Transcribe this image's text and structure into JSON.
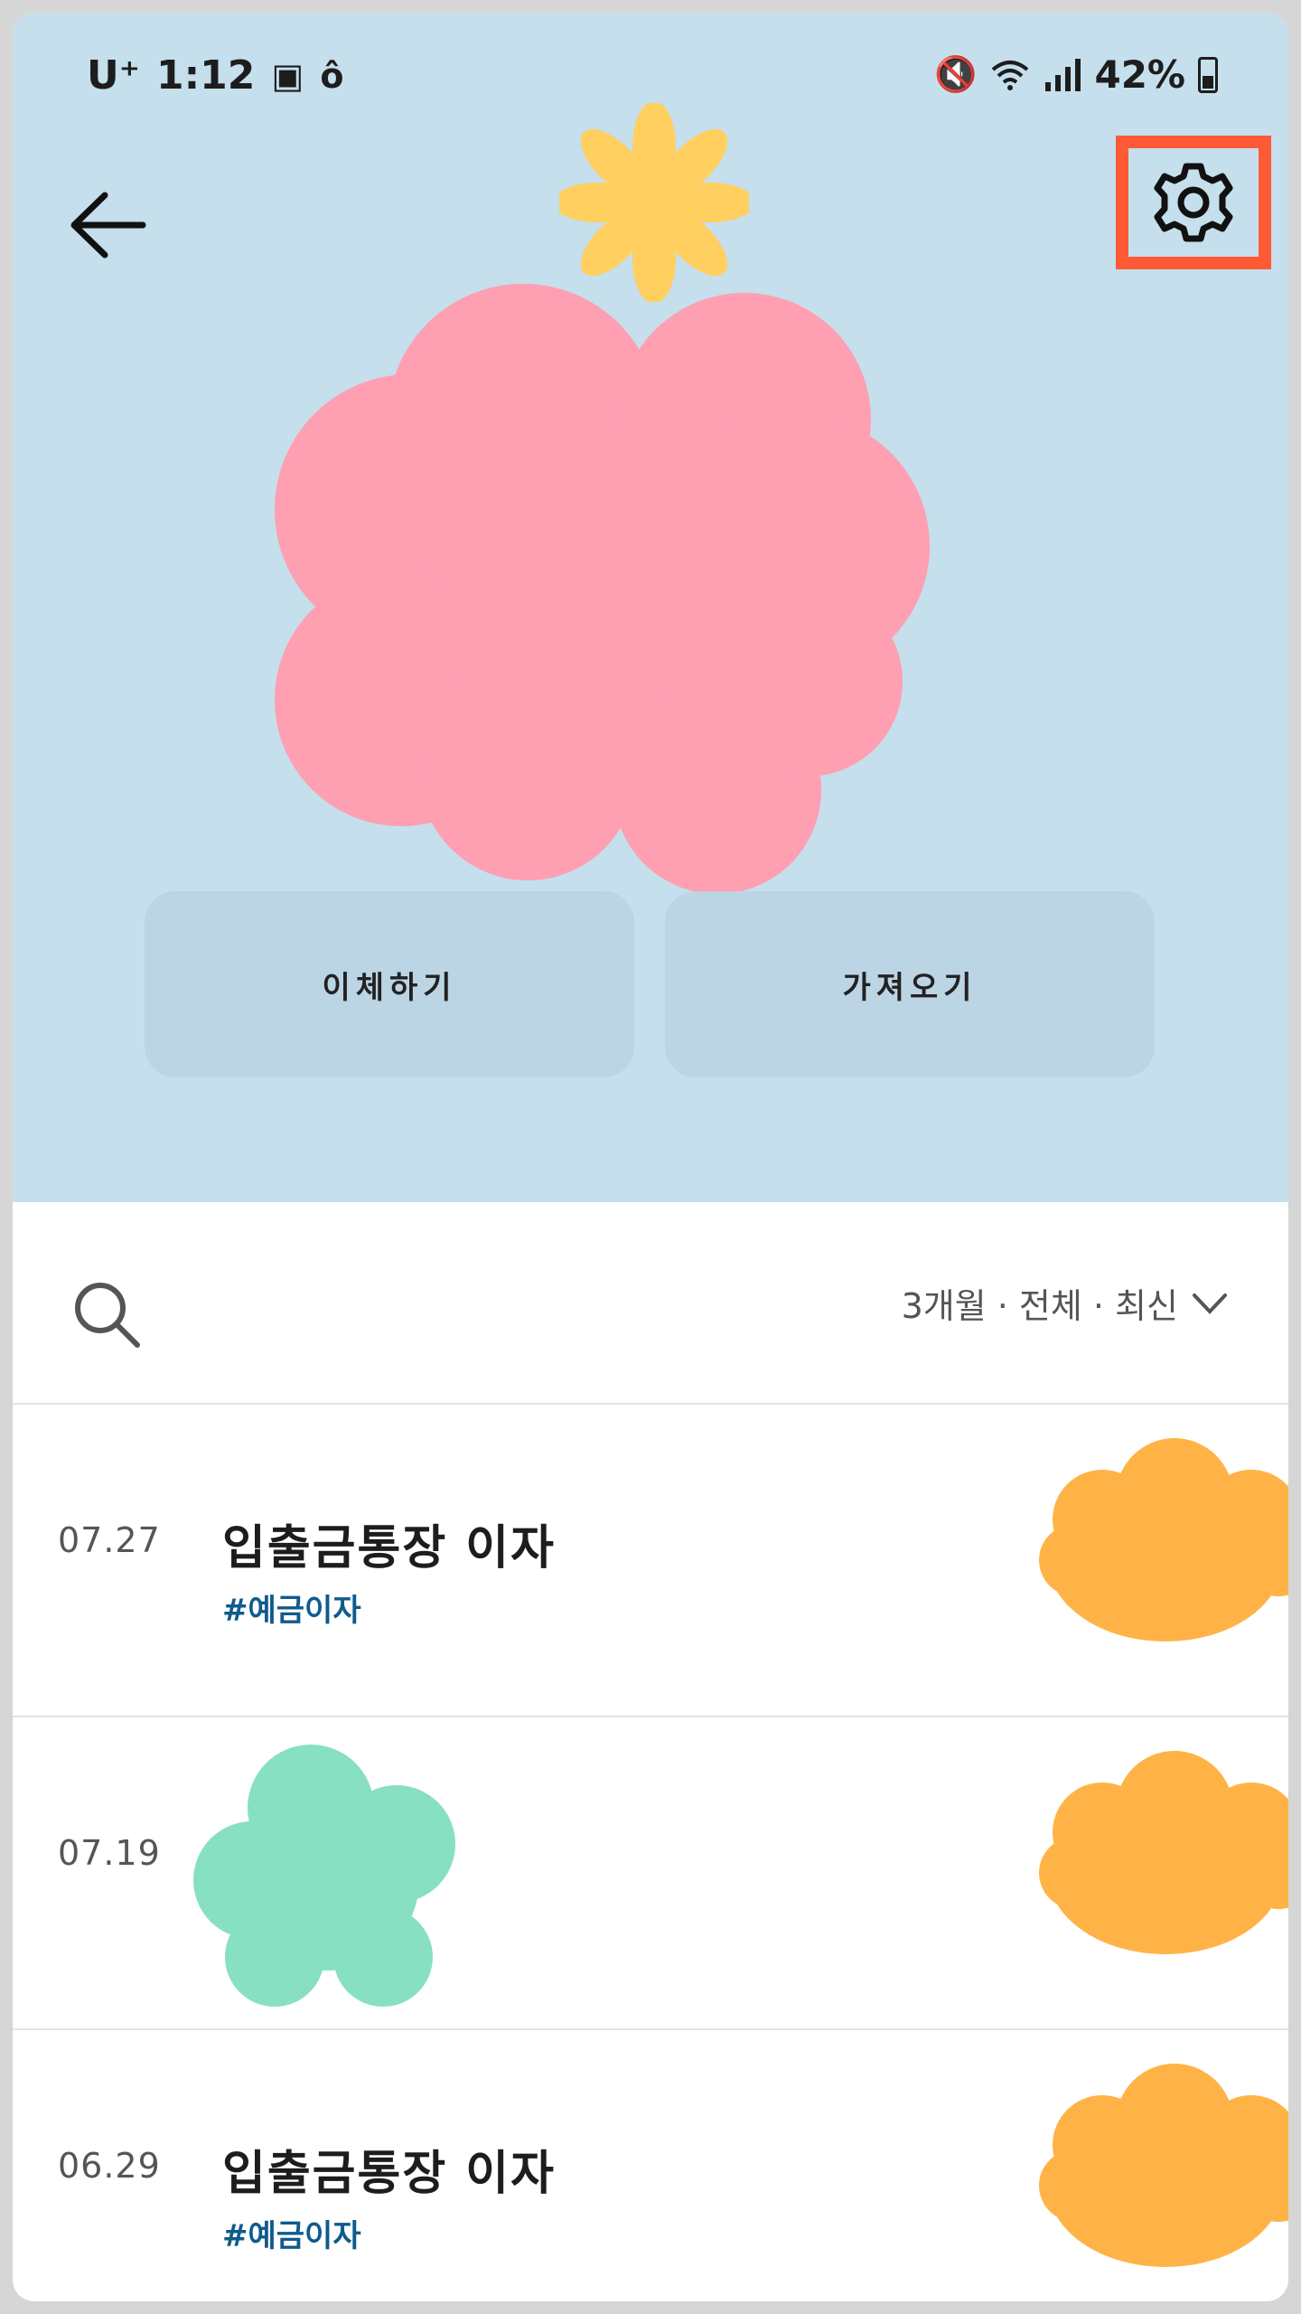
{
  "status_bar": {
    "carrier": "U⁺",
    "time": "1:12",
    "battery": "42%"
  },
  "header": {
    "back_label": "←"
  },
  "actions": {
    "transfer": "이체하기",
    "fetch": "가져오기"
  },
  "filter": {
    "label": "3개월 · 전체 · 최신",
    "chevron": "⌄"
  },
  "transactions": [
    {
      "date": "07.27",
      "title": "입출금통장 이자",
      "tag": "#예금이자"
    },
    {
      "date": "07.19",
      "title": "",
      "tag": ""
    },
    {
      "date": "06.29",
      "title": "입출금통장 이자",
      "tag": "#예금이자"
    }
  ],
  "colors": {
    "hero_bg": "#c5dfec",
    "button_bg": "#bcd5e4",
    "highlight": "#ff5a36",
    "tag": "#0f5b8c",
    "pink_blob": "#ff9fb2",
    "yellow_blob": "#ffd060",
    "orange_blob": "#ffb347",
    "green_blob": "#88e0c2"
  },
  "icons": [
    "back-arrow-icon",
    "gear-icon",
    "search-icon",
    "chevron-down-icon",
    "image-icon",
    "mute-icon",
    "wifi-icon",
    "signal-icon",
    "battery-icon"
  ]
}
